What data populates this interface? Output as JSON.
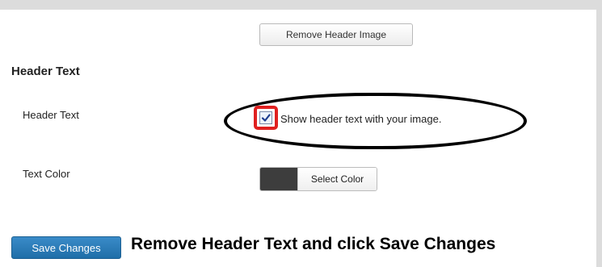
{
  "header_image": {
    "remove_button_label": "Remove Header Image"
  },
  "header_text_section": {
    "title": "Header Text",
    "header_text_row": {
      "label": "Header Text",
      "checkbox_label": "Show header text with your image.",
      "checked": true
    },
    "text_color_row": {
      "label": "Text Color",
      "swatch_color": "#3d3d3d",
      "select_button_label": "Select Color"
    }
  },
  "actions": {
    "save_label": "Save Changes"
  },
  "annotation": {
    "instruction": "Remove Header Text and click Save Changes",
    "ellipse_color": "#000000",
    "highlight_color": "#e02020"
  },
  "theme": {
    "primary": "#2271b1",
    "frame": "#dcdcdc"
  }
}
